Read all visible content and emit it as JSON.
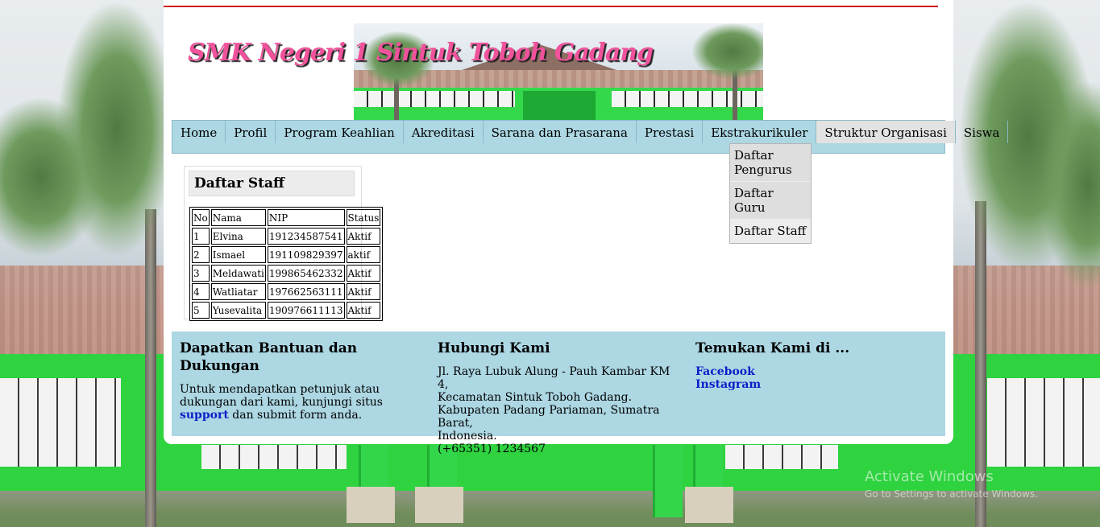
{
  "site": {
    "title": "SMK Negeri 1 Sintuk Toboh Gadang"
  },
  "nav": {
    "items": [
      "Home",
      "Profil",
      "Program Keahlian",
      "Akreditasi",
      "Sarana dan Prasarana",
      "Prestasi",
      "Ekstrakurikuler",
      "Struktur Organisasi",
      "Siswa"
    ],
    "active": "Struktur Organisasi",
    "dropdown": [
      "Daftar Pengurus",
      "Daftar Guru",
      "Daftar Staff"
    ]
  },
  "staff": {
    "heading": "Daftar Staff",
    "columns": [
      "No",
      "Nama",
      "NIP",
      "Status"
    ],
    "rows": [
      [
        "1",
        "Elvina",
        "191234587541",
        "Aktif"
      ],
      [
        "2",
        "Ismael",
        "191109829397",
        "aktif"
      ],
      [
        "3",
        "Meldawati",
        "199865462332",
        "Aktif"
      ],
      [
        "4",
        "Watliatar",
        "197662563111",
        "Aktif"
      ],
      [
        "5",
        "Yusevalita",
        "190976611113",
        "Aktif"
      ]
    ]
  },
  "footer": {
    "help": {
      "heading": "Dapatkan Bantuan dan Dukungan",
      "text_before": "Untuk mendapatkan petunjuk atau dukungan dari kami, kunjungi situs",
      "link": "support",
      "text_after": "dan submit form anda."
    },
    "contact": {
      "heading": "Hubungi Kami",
      "address_line1": "Jl. Raya Lubuk Alung - Pauh Kambar KM 4,",
      "address_line2": "Kecamatan Sintuk Toboh Gadang.",
      "address_line3": "Kabupaten Padang Pariaman, Sumatra Barat,",
      "address_line4": "Indonesia.",
      "phone": "(+65351) 1234567"
    },
    "social": {
      "heading": "Temukan Kami di ...",
      "links": [
        "Facebook",
        "Instagram"
      ]
    }
  },
  "overlay": {
    "activate_title": "Activate Windows",
    "activate_sub": "Go to Settings to activate Windows."
  },
  "colors": {
    "nav_bg": "#acd7e3",
    "title_pink": "#f0529b",
    "link_blue": "#0a1fc9",
    "top_rule_red": "#cc1111"
  }
}
